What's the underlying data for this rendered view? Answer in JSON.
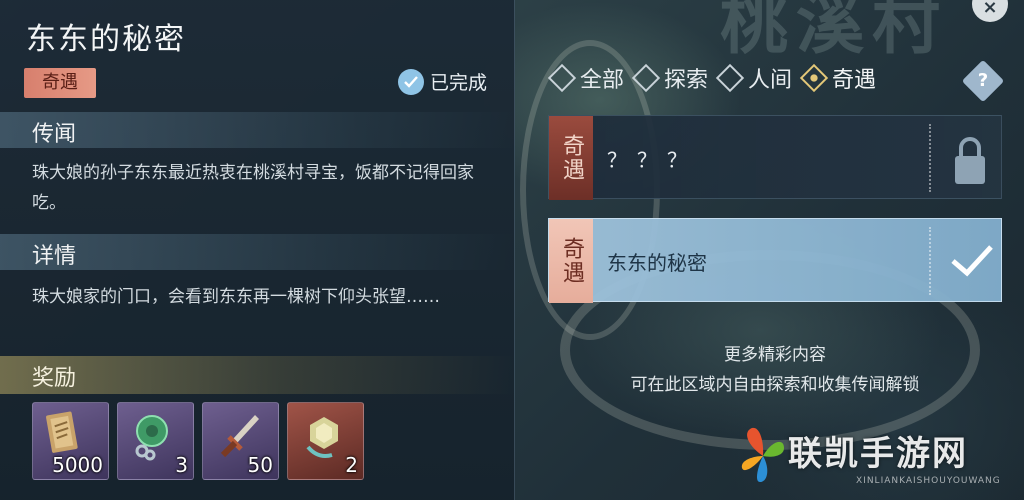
{
  "map": {
    "region_title": "桃溪村"
  },
  "quest": {
    "title": "东东的秘密",
    "type_tag": "奇遇",
    "status": "已完成",
    "sections": [
      {
        "heading": "传闻",
        "text": "珠大娘的孙子东东最近热衷在桃溪村寻宝，饭都不记得回家吃。"
      },
      {
        "heading": "详情",
        "text": "珠大娘家的门口，会看到东东再一棵树下仰头张望……"
      }
    ],
    "reward_heading": "奖励",
    "rewards": [
      {
        "icon": "ticket-scroll-icon",
        "count": "5000",
        "rarity": "purple"
      },
      {
        "icon": "jade-pendant-icon",
        "count": "3",
        "rarity": "purple"
      },
      {
        "icon": "dagger-icon",
        "count": "50",
        "rarity": "purple"
      },
      {
        "icon": "gem-token-icon",
        "count": "2",
        "rarity": "red"
      }
    ]
  },
  "filters": [
    {
      "label": "全部",
      "active": false
    },
    {
      "label": "探索",
      "active": false
    },
    {
      "label": "人间",
      "active": false
    },
    {
      "label": "奇遇",
      "active": true
    }
  ],
  "help_label": "?",
  "quest_list": [
    {
      "tag": "奇遇",
      "name": "？？？",
      "state": "locked"
    },
    {
      "tag": "奇遇",
      "name": "东东的秘密",
      "state": "completed"
    }
  ],
  "hint": {
    "line1": "更多精彩内容",
    "line2": "可在此区域内自由探索和收集传闻解锁"
  },
  "watermark": {
    "text": "联凯手游网",
    "sub": "XINLIANKAISHOUYOUWANG"
  },
  "colors": {
    "type_tag": "#e69a86",
    "status_icon": "#8fc4e6",
    "active_filter": "#e3c778",
    "completed_card": "#a0c3dc"
  }
}
